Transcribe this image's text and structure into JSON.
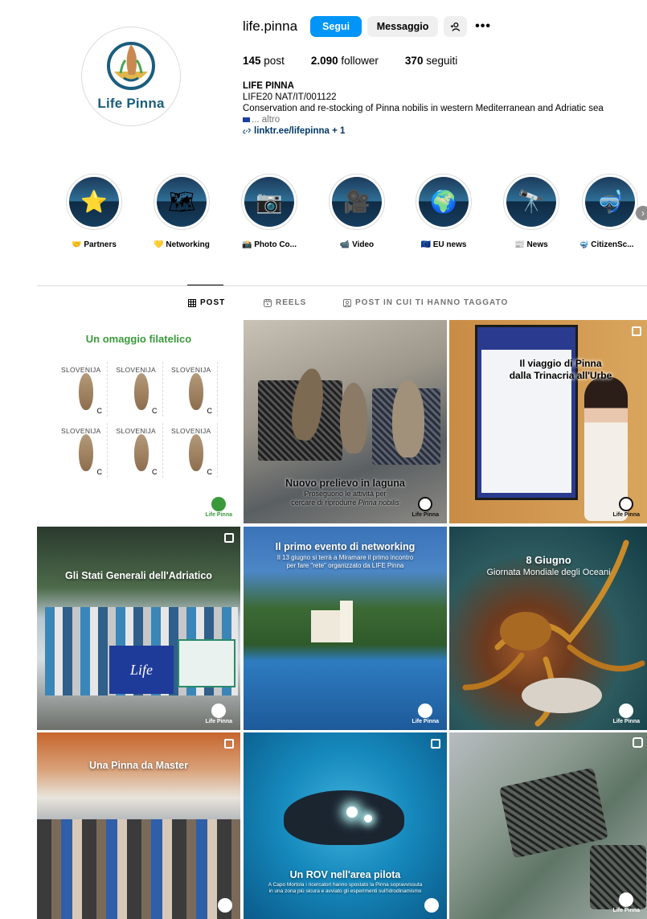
{
  "profile": {
    "username": "life.pinna",
    "follow_label": "Segui",
    "message_label": "Messaggio",
    "logo_text": "Life Pinna",
    "stats": {
      "posts_count": "145",
      "posts_label": "post",
      "followers_count": "2.090",
      "followers_label": "follower",
      "following_count": "370",
      "following_label": "seguiti"
    },
    "bio": {
      "name": "LIFE PINNA",
      "line1": "LIFE20 NAT/IT/001122",
      "line2": "Conservation and re-stocking of Pinna nobilis in western Mediterranean and Adriatic sea",
      "more": "... altro",
      "link": "linktr.ee/lifepinna + 1"
    }
  },
  "highlights": [
    {
      "label": "🤝 Partners",
      "icon": "starfish"
    },
    {
      "label": "💛 Networking",
      "icon": "map"
    },
    {
      "label": "📸 Photo Co...",
      "icon": "camera"
    },
    {
      "label": "📹 Video",
      "icon": "video-camera"
    },
    {
      "label": "🇪🇺 EU news",
      "icon": "globe"
    },
    {
      "label": "📰 News",
      "icon": "binoculars"
    },
    {
      "label": "🤿 CitizenSc...",
      "icon": "snorkel-mask"
    }
  ],
  "tabs": [
    {
      "label": "POST",
      "icon": "grid-icon"
    },
    {
      "label": "REELS",
      "icon": "reels-icon"
    },
    {
      "label": "POST IN CUI TI HANNO TAGGATO",
      "icon": "tagged-icon"
    }
  ],
  "posts": {
    "watermark": "Life Pinna",
    "p1": {
      "title": "Un omaggio filatelico",
      "country": "SLOVENIJA",
      "value": "C"
    },
    "p2": {
      "title": "Nuovo prelievo in laguna",
      "subtitle_a": "Proseguono le attività per",
      "subtitle_b": "cercare di riprodurre",
      "subtitle_c": "Pinna nobilis"
    },
    "p3": {
      "title_a": "Il viaggio di Pinna",
      "title_b": "dalla Trinacria all'Urbe"
    },
    "p4": {
      "title": "Gli Stati Generali dell'Adriatico",
      "flag_text": "Life"
    },
    "p5": {
      "title": "Il primo evento di networking",
      "sub_a": "Il 13 giugno si terrà a Miramare il primo incontro",
      "sub_b": "per fare \"rete\" organizzato da LIFE Pinna"
    },
    "p6": {
      "title_a": "8 Giugno",
      "title_b": "Giornata Mondiale degli Oceani"
    },
    "p7": {
      "title": "Una Pinna da Master"
    },
    "p8": {
      "title": "Un ROV nell'area pilota",
      "sub_a": "A Capo Mortola i ricercatori hanno spostato la Pinna sopravvissuta",
      "sub_b": "in una zona più sicura e avviato gli esperimenti sull'idrodinamismo"
    },
    "p9": {}
  }
}
